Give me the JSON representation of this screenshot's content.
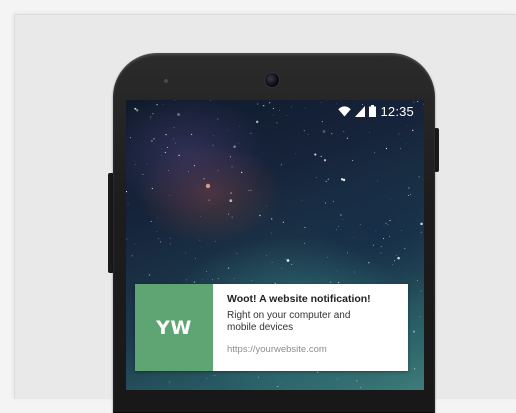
{
  "status_bar": {
    "time": "12:35",
    "icons": [
      "wifi-icon",
      "signal-icon",
      "battery-icon"
    ]
  },
  "notification": {
    "logo_text": "YW",
    "title": "Woot! A website notification!",
    "message": "Right on your computer and mobile devices",
    "url": "https://yourwebsite.com"
  },
  "colors": {
    "logo_bg": "#5fa573",
    "page_bg": "#e9e9e9",
    "phone_body": "#1d1d1d"
  }
}
